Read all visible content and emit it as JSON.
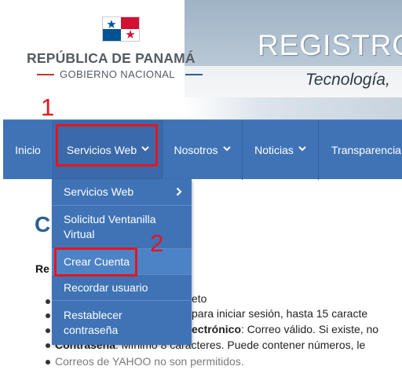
{
  "header": {
    "country": "REPÚBLICA DE PANAMÁ",
    "government": "GOBIERNO NACIONAL",
    "title": "REGISTRO",
    "subtitle": "Tecnología,"
  },
  "annotations": {
    "step1": "1",
    "step2": "2"
  },
  "nav": {
    "items": [
      {
        "label": "Inicio",
        "has_dropdown": false
      },
      {
        "label": "Servicios Web",
        "has_dropdown": true
      },
      {
        "label": "Nosotros",
        "has_dropdown": true
      },
      {
        "label": "Noticias",
        "has_dropdown": true
      },
      {
        "label": "Transparencia",
        "has_dropdown": false
      }
    ]
  },
  "dropdown": {
    "items": [
      {
        "label": "Servicios Web",
        "has_submenu": true
      },
      {
        "label": "Solicitud Ventanilla Virtual"
      },
      {
        "label": "Crear Cuenta"
      },
      {
        "label": "Recordar usuario"
      },
      {
        "label": "Restablecer contraseña"
      }
    ]
  },
  "content": {
    "heading_partial": "C",
    "label_partial": "Re",
    "lines": [
      {
        "text": "eto"
      },
      {
        "text": " para iniciar sesión, hasta 15 caracte"
      },
      {
        "bold": "ectrónico",
        "text": ": Correo válido. Si existe, no"
      },
      {
        "bold": "Contraseña",
        "text": ": Mínimo 8 caracteres. Puede contener números, le"
      },
      {
        "text": "Correos de YAHOO no son permitidos."
      }
    ]
  },
  "icons": {
    "chevron": "chevron-down-icon",
    "submenu": "chevron-right-icon"
  },
  "colors": {
    "nav_bg": "#3f73b6",
    "highlight": "#e8141d",
    "heading": "#2b5f94"
  }
}
